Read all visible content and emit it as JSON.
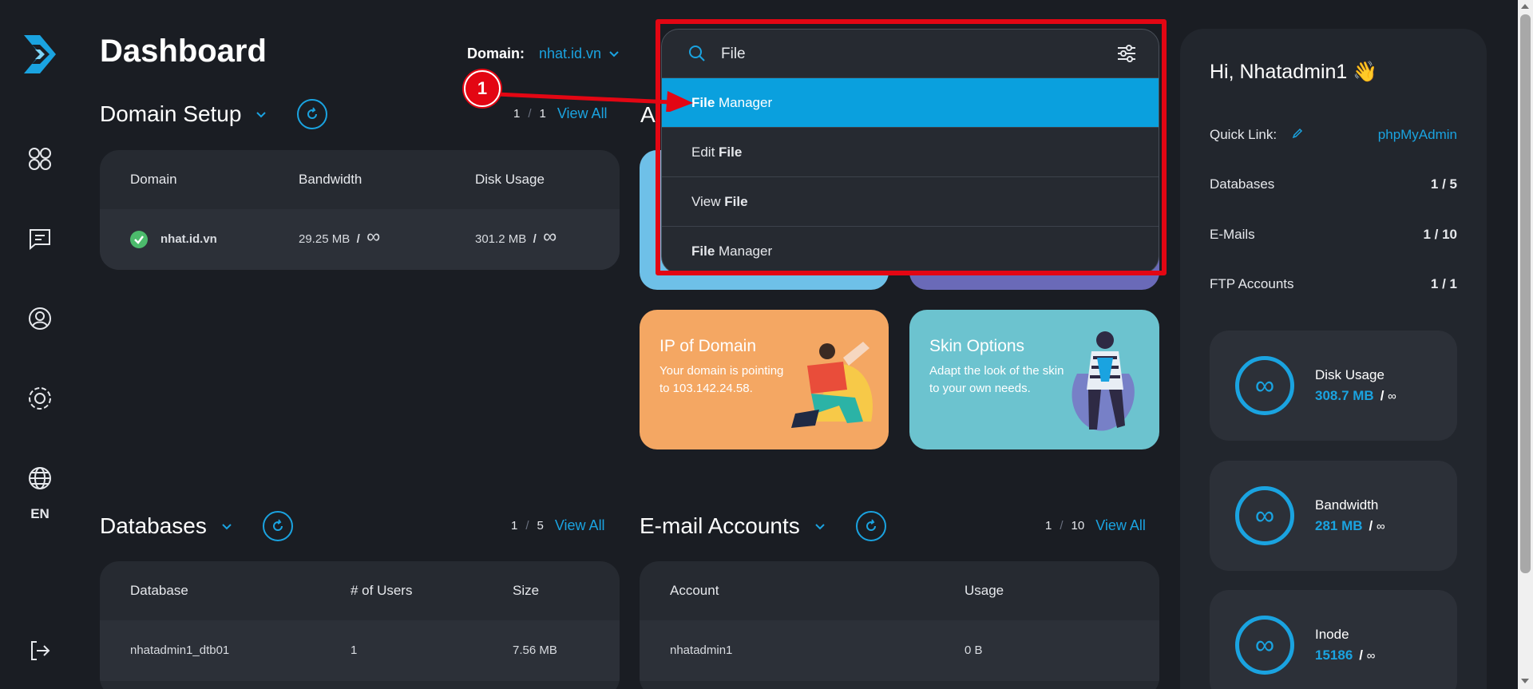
{
  "page": {
    "title": "Dashboard"
  },
  "sidebar": {
    "language": "EN",
    "icons": [
      "logo-icon",
      "dashboard-grid-icon",
      "messages-icon",
      "user-icon",
      "settings-icon",
      "globe-icon",
      "logout-icon"
    ]
  },
  "domain_selector": {
    "label": "Domain:",
    "value": "nhat.id.vn"
  },
  "domain_setup": {
    "title": "Domain Setup",
    "pager": {
      "current": "1",
      "total": "1",
      "view_all": "View All"
    },
    "columns": [
      "Domain",
      "Bandwidth",
      "Disk Usage"
    ],
    "rows": [
      {
        "domain": "nhat.id.vn",
        "bandwidth": "29.25 MB",
        "disk": "301.2 MB",
        "limit": "∞"
      }
    ]
  },
  "promos": [
    {
      "title": "IP of Domain",
      "text": "Your domain is pointing to 103.142.24.58.",
      "color": "#f4a763"
    },
    {
      "title": "Skin Options",
      "text": "Adapt the look of the skin to your own needs.",
      "color": "#6cc3cf"
    }
  ],
  "databases": {
    "title": "Databases",
    "pager": {
      "current": "1",
      "total": "5",
      "view_all": "View All"
    },
    "columns": [
      "Database",
      "# of Users",
      "Size"
    ],
    "rows": [
      {
        "name": "nhatadmin1_dtb01",
        "users": "1",
        "size": "7.56 MB"
      }
    ]
  },
  "email_accounts": {
    "title": "E-mail Accounts",
    "pager": {
      "current": "1",
      "total": "10",
      "view_all": "View All"
    },
    "columns": [
      "Account",
      "Usage"
    ],
    "rows": [
      {
        "account": "nhatadmin1",
        "usage": "0 B"
      }
    ]
  },
  "right_panel": {
    "greeting": "Hi, Nhatadmin1",
    "wave": "👋",
    "quick_link_label": "Quick Link:",
    "quick_link_value": "phpMyAdmin",
    "stats": [
      {
        "label": "Databases",
        "value": "1 / 5"
      },
      {
        "label": "E-Mails",
        "value": "1 / 10"
      },
      {
        "label": "FTP Accounts",
        "value": "1 / 1"
      }
    ],
    "usage": [
      {
        "title": "Disk Usage",
        "used": "308.7 MB",
        "limit": "∞"
      },
      {
        "title": "Bandwidth",
        "used": "281 MB",
        "limit": "∞"
      },
      {
        "title": "Inode",
        "used": "15186",
        "limit": "∞"
      }
    ]
  },
  "search": {
    "value": "File",
    "results": [
      {
        "bold": "File",
        "rest": " Manager",
        "bold_first": true
      },
      {
        "bold": "File",
        "rest": "Edit ",
        "bold_first": false
      },
      {
        "bold": "File",
        "rest": "View ",
        "bold_first": false
      },
      {
        "bold": "File",
        "rest": " Manager",
        "bold_first": true
      }
    ]
  },
  "annotation": {
    "step": "1",
    "color": "#e30613"
  },
  "colors": {
    "accent": "#1aa3e0",
    "background": "#1a1d23",
    "card": "#262a31",
    "active": "#0aa0de"
  }
}
